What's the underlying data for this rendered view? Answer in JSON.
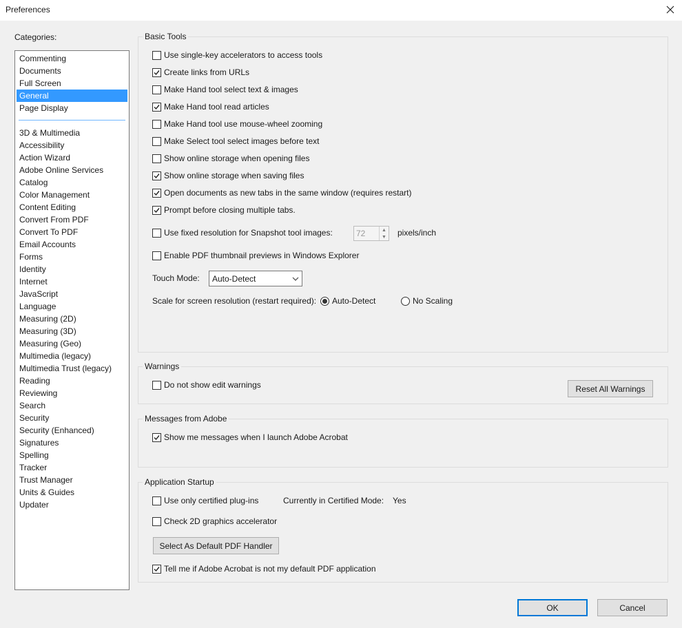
{
  "window": {
    "title": "Preferences"
  },
  "categories": {
    "label": "Categories:",
    "top_items": [
      "Commenting",
      "Documents",
      "Full Screen",
      "General",
      "Page Display"
    ],
    "selected": "General",
    "items": [
      "3D & Multimedia",
      "Accessibility",
      "Action Wizard",
      "Adobe Online Services",
      "Catalog",
      "Color Management",
      "Content Editing",
      "Convert From PDF",
      "Convert To PDF",
      "Email Accounts",
      "Forms",
      "Identity",
      "Internet",
      "JavaScript",
      "Language",
      "Measuring (2D)",
      "Measuring (3D)",
      "Measuring (Geo)",
      "Multimedia (legacy)",
      "Multimedia Trust (legacy)",
      "Reading",
      "Reviewing",
      "Search",
      "Security",
      "Security (Enhanced)",
      "Signatures",
      "Spelling",
      "Tracker",
      "Trust Manager",
      "Units & Guides",
      "Updater"
    ]
  },
  "basic_tools": {
    "title": "Basic Tools",
    "options": [
      {
        "label": "Use single-key accelerators to access tools",
        "checked": false
      },
      {
        "label": "Create links from URLs",
        "checked": true
      },
      {
        "label": "Make Hand tool select text & images",
        "checked": false
      },
      {
        "label": "Make Hand tool read articles",
        "checked": true
      },
      {
        "label": "Make Hand tool use mouse-wheel zooming",
        "checked": false
      },
      {
        "label": "Make Select tool select images before text",
        "checked": false
      },
      {
        "label": "Show online storage when opening files",
        "checked": false
      },
      {
        "label": "Show online storage when saving files",
        "checked": true
      },
      {
        "label": "Open documents as new tabs in the same window (requires restart)",
        "checked": true
      },
      {
        "label": "Prompt before closing multiple tabs.",
        "checked": true
      }
    ],
    "snapshot": {
      "label": "Use fixed resolution for Snapshot tool images:",
      "checked": false,
      "value": "72",
      "unit": "pixels/inch"
    },
    "thumbnail": {
      "label": "Enable PDF thumbnail previews in Windows Explorer",
      "checked": false
    },
    "touch_mode": {
      "label": "Touch Mode:",
      "value": "Auto-Detect"
    },
    "scale": {
      "label": "Scale for screen resolution (restart required):",
      "option1": "Auto-Detect",
      "option2": "No Scaling",
      "selected": "Auto-Detect"
    }
  },
  "warnings": {
    "title": "Warnings",
    "option": {
      "label": "Do not show edit warnings",
      "checked": false
    },
    "reset_button": "Reset All Warnings"
  },
  "messages": {
    "title": "Messages from Adobe",
    "option": {
      "label": "Show me messages when I launch Adobe Acrobat",
      "checked": true
    }
  },
  "startup": {
    "title": "Application Startup",
    "certified": {
      "label": "Use only certified plug-ins",
      "checked": false
    },
    "certified_mode_label": "Currently in Certified Mode:",
    "certified_mode_value": "Yes",
    "graphics": {
      "label": "Check 2D graphics accelerator",
      "checked": false
    },
    "default_button": "Select As Default PDF Handler",
    "tell_me": {
      "label": "Tell me if Adobe Acrobat is not my default PDF application",
      "checked": true
    }
  },
  "buttons": {
    "ok": "OK",
    "cancel": "Cancel"
  }
}
